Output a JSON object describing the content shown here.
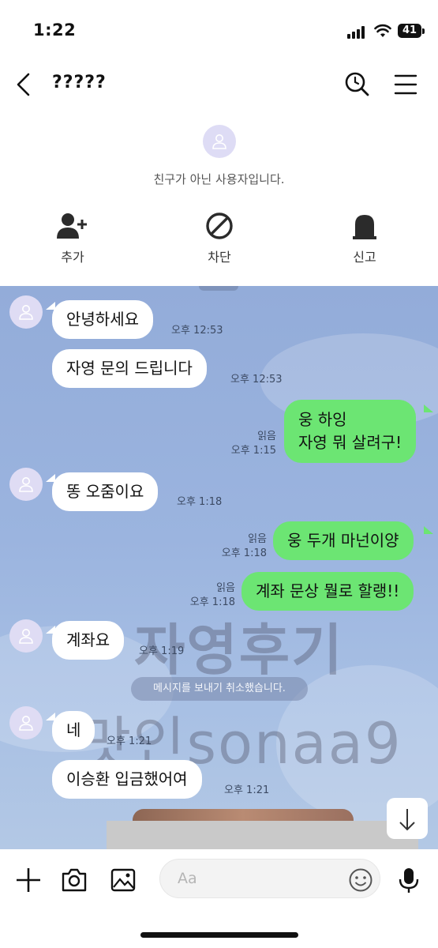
{
  "status": {
    "time": "1:22",
    "battery": "41"
  },
  "header": {
    "title": "?????"
  },
  "profile": {
    "notice": "친구가 아닌 사용자입니다."
  },
  "actions": {
    "add": "추가",
    "block": "차단",
    "report": "신고"
  },
  "messages": [
    {
      "side": "in",
      "text": "안녕하세요",
      "time": "오후 12:53"
    },
    {
      "side": "in",
      "text": "자영 문의 드립니다",
      "time": "오후 12:53"
    },
    {
      "side": "out",
      "lines": [
        "웅 하잉",
        "자영 뭐 살려구!"
      ],
      "read": "읽음",
      "time": "오후 1:15"
    },
    {
      "side": "in",
      "text": "똥 오줌이요",
      "time": "오후 1:18"
    },
    {
      "side": "out",
      "text": "웅 두개 마넌이양",
      "read": "읽음",
      "time": "오후 1:18"
    },
    {
      "side": "out",
      "text": "계좌 문상 뭘로 할랭!!",
      "read": "읽음",
      "time": "오후 1:18"
    },
    {
      "side": "in",
      "text": "계좌요",
      "time": "오후 1:19"
    },
    {
      "side": "in",
      "text": "네",
      "time": "오후 1:21"
    },
    {
      "side": "in",
      "text": "이승환 입금했어여",
      "time": "오후 1:21"
    }
  ],
  "system_message": "메시지를 보내기 취소했습니다.",
  "watermark": {
    "line1": "자영후기",
    "line2": "맛인sonaa9"
  },
  "input": {
    "placeholder": "Aa"
  },
  "colors": {
    "chat_bg": "#9bb4df",
    "outgoing": "#6ce573",
    "incoming": "#ffffff"
  }
}
